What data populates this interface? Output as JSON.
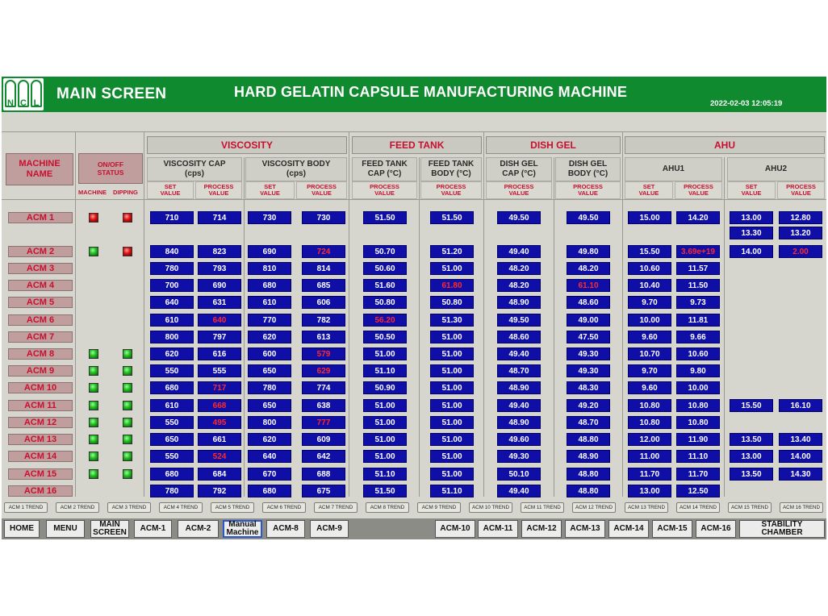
{
  "header": {
    "logo_text": "NCL",
    "logo_letters": [
      "N",
      "C",
      "L"
    ],
    "title": "MAIN SCREEN",
    "machine_name": "HARD GELATIN CAPSULE MANUFACTURING MACHINE",
    "datetime": "2022-02-03 12:05:19"
  },
  "table": {
    "machine_name_header": "MACHINE\nNAME",
    "onoff_header": "ON/OFF\nSTATUS",
    "machine_label": "MACHINE",
    "dipping_label": "DIPPING",
    "groups": {
      "viscosity": "VISCOSITY",
      "feed_tank": "FEED TANK",
      "dish_gel": "DISH GEL",
      "ahu": "AHU"
    },
    "sub": {
      "viscosity_cap": "VISCOSITY CAP\n(cps)",
      "viscosity_body": "VISCOSITY BODY\n(cps)",
      "feed_tank_cap": "FEED TANK\nCAP (°C)",
      "feed_tank_body": "FEED TANK\nBODY (°C)",
      "dish_gel_cap": "DISH GEL\nCAP (°C)",
      "dish_gel_body": "DISH GEL\nBODY (°C)",
      "ahu1": "AHU1",
      "ahu2": "AHU2"
    },
    "set_value": "SET\nVALUE",
    "process_value": "PROCESS\nVALUE"
  },
  "status_colors": {
    "on": "#1fbf1f",
    "off": "#e01010",
    "alarm_text": "#ff2a2a",
    "value_box": "#0f0fa8"
  },
  "rows": [
    {
      "name": "ACM 1",
      "machine": "off",
      "dipping": "off",
      "vc_sv": "710",
      "vc_pv": "714",
      "vb_sv": "730",
      "vb_pv": "730",
      "ft_cap": "51.50",
      "ft_body": "51.50",
      "dg_cap": "49.50",
      "dg_body": "49.50",
      "ahu1_sv": "15.00",
      "ahu1_pv": "14.20",
      "ahu2_sv": "13.00",
      "ahu2_pv": "12.80"
    },
    {
      "name": "ACM 2",
      "machine": "on",
      "dipping": "off",
      "vc_sv": "840",
      "vc_pv": "823",
      "vb_sv": "690",
      "vb_pv": "724",
      "ft_cap": "50.70",
      "ft_body": "51.20",
      "dg_cap": "49.40",
      "dg_body": "49.80",
      "ahu1_sv": "15.50",
      "ahu1_pv": "3.69e+19",
      "ahu2_sv": "14.00",
      "ahu2_pv": "2.00"
    },
    {
      "name": "ACM 3",
      "vc_sv": "780",
      "vc_pv": "793",
      "vb_sv": "810",
      "vb_pv": "814",
      "ft_cap": "50.60",
      "ft_body": "51.00",
      "dg_cap": "48.20",
      "dg_body": "48.20",
      "ahu1_sv": "10.60",
      "ahu1_pv": "11.57"
    },
    {
      "name": "ACM 4",
      "vc_sv": "700",
      "vc_pv": "690",
      "vb_sv": "680",
      "vb_pv": "685",
      "ft_cap": "51.60",
      "ft_body": "61.80",
      "dg_cap": "48.20",
      "dg_body": "61.10",
      "ahu1_sv": "10.40",
      "ahu1_pv": "11.50"
    },
    {
      "name": "ACM 5",
      "vc_sv": "640",
      "vc_pv": "631",
      "vb_sv": "610",
      "vb_pv": "606",
      "ft_cap": "50.80",
      "ft_body": "50.80",
      "dg_cap": "48.90",
      "dg_body": "48.60",
      "ahu1_sv": "9.70",
      "ahu1_pv": "9.73"
    },
    {
      "name": "ACM 6",
      "vc_sv": "610",
      "vc_pv": "640",
      "vb_sv": "770",
      "vb_pv": "782",
      "ft_cap": "56.20",
      "ft_body": "51.30",
      "dg_cap": "49.50",
      "dg_body": "49.00",
      "ahu1_sv": "10.00",
      "ahu1_pv": "11.81"
    },
    {
      "name": "ACM 7",
      "vc_sv": "800",
      "vc_pv": "797",
      "vb_sv": "620",
      "vb_pv": "613",
      "ft_cap": "50.50",
      "ft_body": "51.00",
      "dg_cap": "48.60",
      "dg_body": "47.50",
      "ahu1_sv": "9.60",
      "ahu1_pv": "9.66"
    },
    {
      "name": "ACM 8",
      "machine": "on",
      "dipping": "on",
      "vc_sv": "620",
      "vc_pv": "616",
      "vb_sv": "600",
      "vb_pv": "579",
      "ft_cap": "51.00",
      "ft_body": "51.00",
      "dg_cap": "49.40",
      "dg_body": "49.30",
      "ahu1_sv": "10.70",
      "ahu1_pv": "10.60"
    },
    {
      "name": "ACM 9",
      "machine": "on",
      "dipping": "on",
      "vc_sv": "550",
      "vc_pv": "555",
      "vb_sv": "650",
      "vb_pv": "629",
      "ft_cap": "51.10",
      "ft_body": "51.00",
      "dg_cap": "48.70",
      "dg_body": "49.30",
      "ahu1_sv": "9.70",
      "ahu1_pv": "9.80"
    },
    {
      "name": "ACM 10",
      "machine": "on",
      "dipping": "on",
      "vc_sv": "680",
      "vc_pv": "717",
      "vb_sv": "780",
      "vb_pv": "774",
      "ft_cap": "50.90",
      "ft_body": "51.00",
      "dg_cap": "48.90",
      "dg_body": "48.30",
      "ahu1_sv": "9.60",
      "ahu1_pv": "10.00"
    },
    {
      "name": "ACM 11",
      "machine": "on",
      "dipping": "on",
      "vc_sv": "610",
      "vc_pv": "668",
      "vb_sv": "650",
      "vb_pv": "638",
      "ft_cap": "51.00",
      "ft_body": "51.00",
      "dg_cap": "49.40",
      "dg_body": "49.20",
      "ahu1_sv": "10.80",
      "ahu1_pv": "10.80",
      "ahu2_sv": "15.50",
      "ahu2_pv": "16.10"
    },
    {
      "name": "ACM 12",
      "machine": "on",
      "dipping": "on",
      "vc_sv": "550",
      "vc_pv": "495",
      "vb_sv": "800",
      "vb_pv": "777",
      "ft_cap": "51.00",
      "ft_body": "51.00",
      "dg_cap": "48.90",
      "dg_body": "48.70",
      "ahu1_sv": "10.80",
      "ahu1_pv": "10.80"
    },
    {
      "name": "ACM 13",
      "machine": "on",
      "dipping": "on",
      "vc_sv": "650",
      "vc_pv": "661",
      "vb_sv": "620",
      "vb_pv": "609",
      "ft_cap": "51.00",
      "ft_body": "51.00",
      "dg_cap": "49.60",
      "dg_body": "48.80",
      "ahu1_sv": "12.00",
      "ahu1_pv": "11.90",
      "ahu2_sv": "13.50",
      "ahu2_pv": "13.40"
    },
    {
      "name": "ACM 14",
      "machine": "on",
      "dipping": "on",
      "vc_sv": "550",
      "vc_pv": "524",
      "vb_sv": "640",
      "vb_pv": "642",
      "ft_cap": "51.00",
      "ft_body": "51.00",
      "dg_cap": "49.30",
      "dg_body": "48.90",
      "ahu1_sv": "11.00",
      "ahu1_pv": "11.10",
      "ahu2_sv": "13.00",
      "ahu2_pv": "14.00"
    },
    {
      "name": "ACM 15",
      "machine": "on",
      "dipping": "on",
      "vc_sv": "680",
      "vc_pv": "684",
      "vb_sv": "670",
      "vb_pv": "688",
      "ft_cap": "51.10",
      "ft_body": "51.00",
      "dg_cap": "50.10",
      "dg_body": "48.80",
      "ahu1_sv": "11.70",
      "ahu1_pv": "11.70",
      "ahu2_sv": "13.50",
      "ahu2_pv": "14.30"
    },
    {
      "name": "ACM 16",
      "vc_sv": "780",
      "vc_pv": "792",
      "vb_sv": "680",
      "vb_pv": "675",
      "ft_cap": "51.50",
      "ft_body": "51.10",
      "dg_cap": "49.40",
      "dg_body": "48.80",
      "ahu1_sv": "13.00",
      "ahu1_pv": "12.50"
    }
  ],
  "extra_ahu2": {
    "sv": "13.30",
    "pv": "13.20"
  },
  "alarms": [
    "vb_pv:ACM 2",
    "ahu1_pv:ACM 2",
    "ahu2_pv:ACM 2",
    "ft_body:ACM 4",
    "dg_body:ACM 4",
    "vc_pv:ACM 6",
    "ft_cap:ACM 6",
    "vb_pv:ACM 8",
    "vb_pv:ACM 9",
    "vc_pv:ACM 10",
    "vc_pv:ACM 11",
    "vc_pv:ACM 12",
    "vb_pv:ACM 12",
    "vc_pv:ACM 14"
  ],
  "trend_buttons": [
    "ACM 1 TREND",
    "ACM 2 TREND",
    "ACM 3 TREND",
    "ACM 4 TREND",
    "ACM 5 TREND",
    "ACM 6 TREND",
    "ACM 7 TREND",
    "ACM 8 TREND",
    "ACM 9 TREND",
    "ACM 10 TREND",
    "ACM 11 TREND",
    "ACM 12 TREND",
    "ACM 13 TREND",
    "ACM 14 TREND",
    "ACM 15 TREND",
    "ACM 16 TREND"
  ],
  "nav": {
    "home": "HOME",
    "menu": "MENU",
    "main_screen": "MAIN\nSCREEN",
    "acm1": "ACM-1",
    "acm2": "ACM-2",
    "manual_machine": "Manual\nMachine",
    "acm8": "ACM-8",
    "acm9": "ACM-9",
    "acm10": "ACM-10",
    "acm11": "ACM-11",
    "acm12": "ACM-12",
    "acm13": "ACM-13",
    "acm14": "ACM-14",
    "acm15": "ACM-15",
    "acm16": "ACM-16",
    "stability_chamber": "STABILITY CHAMBER"
  }
}
